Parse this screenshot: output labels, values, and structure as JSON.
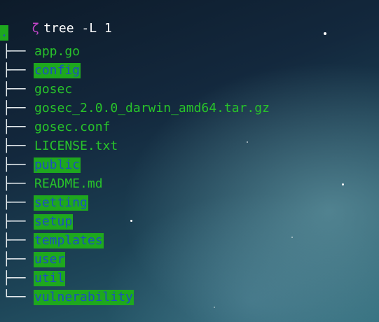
{
  "prompt": {
    "symbol": "ζ",
    "command": "tree -L 1"
  },
  "root": ".",
  "entries": [
    {
      "prefix": "├──",
      "name": "app.go",
      "kind": "file"
    },
    {
      "prefix": "├──",
      "name": "config",
      "kind": "dir"
    },
    {
      "prefix": "├──",
      "name": "gosec",
      "kind": "file"
    },
    {
      "prefix": "├──",
      "name": "gosec_2.0.0_darwin_amd64.tar.gz",
      "kind": "file"
    },
    {
      "prefix": "├──",
      "name": "gosec.conf",
      "kind": "file"
    },
    {
      "prefix": "├──",
      "name": "LICENSE.txt",
      "kind": "file"
    },
    {
      "prefix": "├──",
      "name": "public",
      "kind": "dir"
    },
    {
      "prefix": "├──",
      "name": "README.md",
      "kind": "file"
    },
    {
      "prefix": "├──",
      "name": "setting",
      "kind": "dir"
    },
    {
      "prefix": "├──",
      "name": "setup",
      "kind": "dir"
    },
    {
      "prefix": "├──",
      "name": "templates",
      "kind": "dir"
    },
    {
      "prefix": "├──",
      "name": "user",
      "kind": "dir"
    },
    {
      "prefix": "├──",
      "name": "util",
      "kind": "dir"
    },
    {
      "prefix": "└──",
      "name": "vulnerability",
      "kind": "dir"
    }
  ],
  "colors": {
    "file_text": "#28c42a",
    "dir_text": "#1f4fbf",
    "dir_highlight": "#1ea81e",
    "prompt_symbol": "#c445c9",
    "command_text": "#ffffff"
  }
}
